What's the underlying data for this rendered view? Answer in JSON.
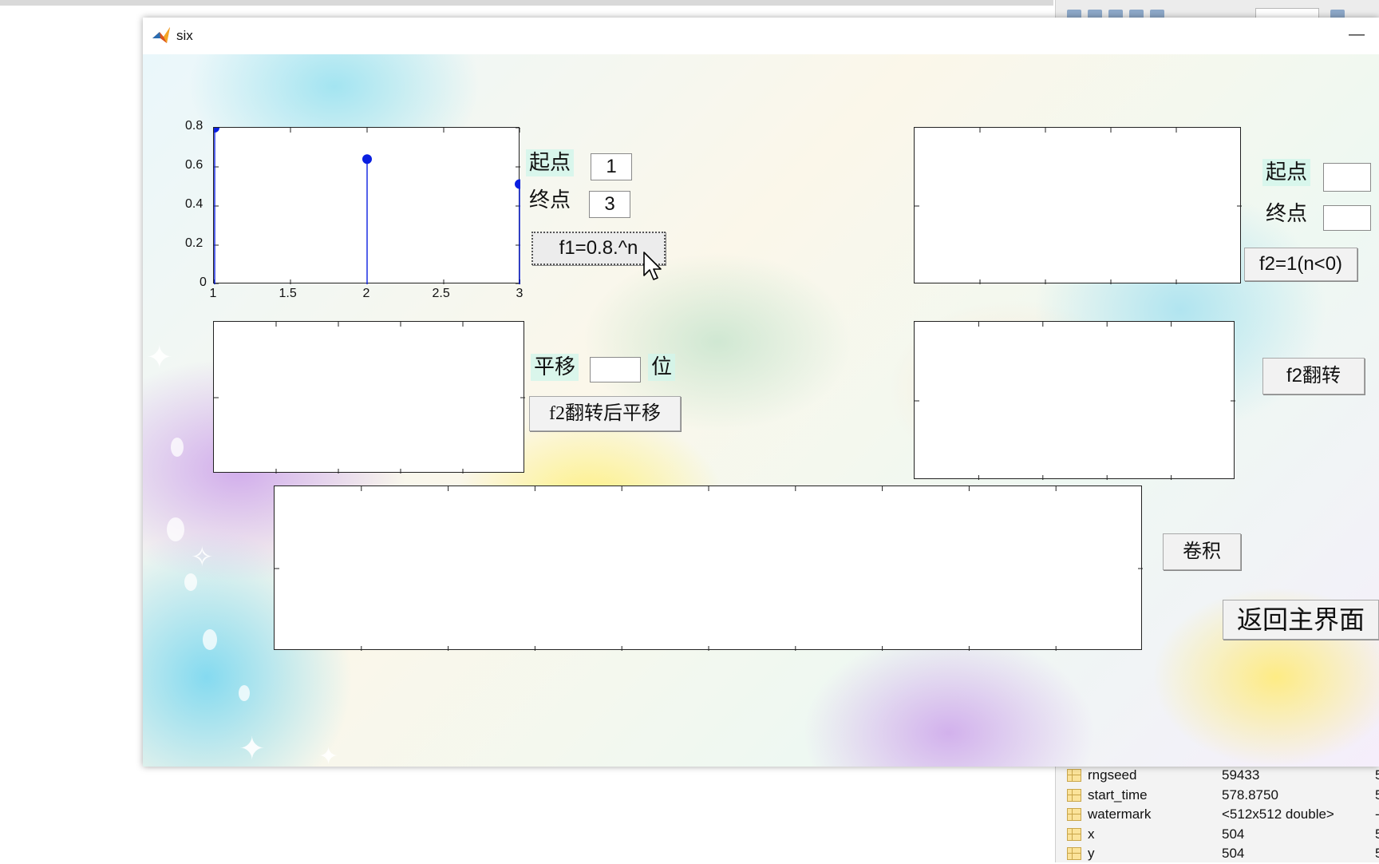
{
  "window": {
    "title": "six"
  },
  "topleft_plot": {
    "x_ticks": [
      "1",
      "1.5",
      "2",
      "2.5",
      "3"
    ],
    "y_ticks": [
      "0",
      "0.2",
      "0.4",
      "0.6",
      "0.8"
    ]
  },
  "chart_data": {
    "type": "scatter",
    "title": "",
    "xlabel": "",
    "ylabel": "",
    "x": [
      1,
      2,
      3
    ],
    "values": [
      0.8,
      0.64,
      0.512
    ],
    "xlim": [
      1,
      3
    ],
    "ylim": [
      0,
      0.8
    ],
    "style": "stem",
    "color": "#0a1fe0"
  },
  "controls": {
    "f1_start_label": "起点",
    "f1_start_value": "1",
    "f1_end_label": "终点",
    "f1_end_value": "3",
    "f1_button": "f1=0.8.^n",
    "shift_label": "平移",
    "shift_value": "",
    "shift_unit": "位",
    "shift_button": "f2翻转后平移",
    "f2_start_label": "起点",
    "f2_start_value": "",
    "f2_end_label": "终点",
    "f2_end_value": "",
    "f2_button": "f2=1(n<0)",
    "flip_button": "f2翻转",
    "conv_button": "卷积",
    "back_button": "返回主界面"
  },
  "workspace": {
    "rows": [
      {
        "name": "rngseed",
        "value": "59433",
        "extra": "5"
      },
      {
        "name": "start_time",
        "value": "578.8750",
        "extra": "5"
      },
      {
        "name": "watermark",
        "value": "<512x512 double>",
        "extra": "-"
      },
      {
        "name": "x",
        "value": "504",
        "extra": "5"
      },
      {
        "name": "y",
        "value": "504",
        "extra": "5"
      }
    ]
  },
  "colors": {
    "stem": "#0a1fe0",
    "accent": "#f0a020"
  }
}
